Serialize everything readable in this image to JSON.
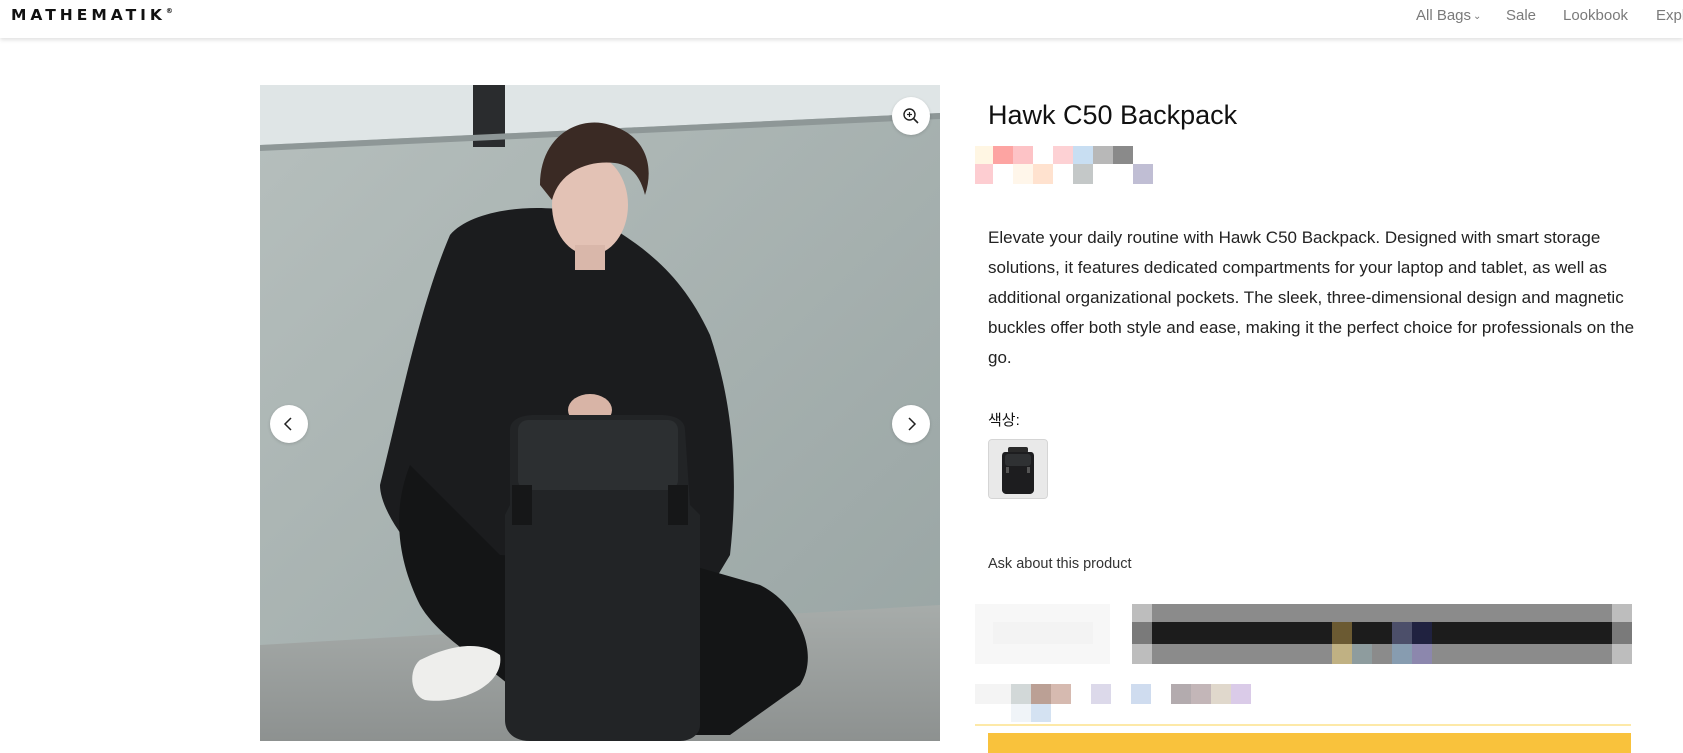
{
  "header": {
    "logo": "MATHEMATIK",
    "logo_mark": "®",
    "nav": {
      "all_bags": "All Bags",
      "sale": "Sale",
      "lookbook": "Lookbook",
      "explore": "Expl"
    }
  },
  "product": {
    "title": "Hawk C50 Backpack",
    "description": "Elevate your daily routine with Hawk C50 Backpack. Designed with smart storage solutions, it features dedicated compartments for your laptop and tablet, as well as additional organizational pockets. The sleek, three-dimensional design and magnetic buckles offer both style and ease, making it the perfect choice for professionals on the go.",
    "color_label": "색상:",
    "ask": "Ask about this product"
  },
  "colors": {
    "accent_yellow": "#f9c23c",
    "nav_gray": "#7a7a7a"
  }
}
